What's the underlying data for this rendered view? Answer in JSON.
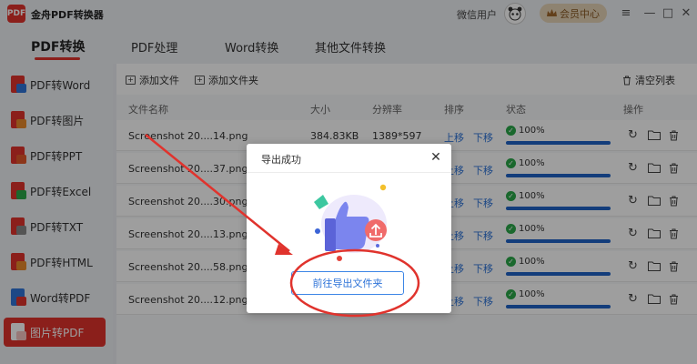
{
  "app": {
    "title": "金舟PDF转换器",
    "logo_text": "PDF",
    "user": "微信用户",
    "vip_label": "会员中心",
    "vip_icon": "crown-icon"
  },
  "window_controls": {
    "menu": "≡",
    "minimize": "—",
    "maximize": "□",
    "close": "✕"
  },
  "tabs": [
    {
      "label": "PDF转换",
      "active": true
    },
    {
      "label": "PDF处理",
      "active": false
    },
    {
      "label": "Word转换",
      "active": false
    },
    {
      "label": "其他文件转换",
      "active": false
    }
  ],
  "sidebar": {
    "items": [
      {
        "label": "PDF转Word",
        "icon": "pdf-to-word-icon",
        "icon_color": "#e0332d",
        "badge_color": "#2f74d8",
        "active": false
      },
      {
        "label": "PDF转图片",
        "icon": "pdf-to-image-icon",
        "icon_color": "#e0332d",
        "badge_color": "#e88a2a",
        "active": false
      },
      {
        "label": "PDF转PPT",
        "icon": "pdf-to-ppt-icon",
        "icon_color": "#e0332d",
        "badge_color": "#e2572b",
        "active": false
      },
      {
        "label": "PDF转Excel",
        "icon": "pdf-to-excel-icon",
        "icon_color": "#e0332d",
        "badge_color": "#2aa84a",
        "active": false
      },
      {
        "label": "PDF转TXT",
        "icon": "pdf-to-txt-icon",
        "icon_color": "#e0332d",
        "badge_color": "#888888",
        "active": false
      },
      {
        "label": "PDF转HTML",
        "icon": "pdf-to-html-icon",
        "icon_color": "#e0332d",
        "badge_color": "#e88a2a",
        "active": false
      },
      {
        "label": "Word转PDF",
        "icon": "word-to-pdf-icon",
        "icon_color": "#2f74d8",
        "badge_color": "#e0332d",
        "active": false
      },
      {
        "label": "图片转PDF",
        "icon": "image-to-pdf-icon",
        "icon_color": "#ffffff",
        "badge_color": "#ffffff",
        "active": true
      }
    ]
  },
  "toolbar": {
    "add_file": "添加文件",
    "add_folder": "添加文件夹",
    "clear_list": "清空列表"
  },
  "columns": {
    "name": "文件名称",
    "size": "大小",
    "resolution": "分辨率",
    "order": "排序",
    "status": "状态",
    "actions": "操作"
  },
  "rows": [
    {
      "name": "Screenshot 20....14.png",
      "size": "384.83KB",
      "resolution": "1389*597",
      "up": "上移",
      "down": "下移",
      "progress_text": "100%",
      "progress": 1.0
    },
    {
      "name": "Screenshot 20....37.png",
      "size": "",
      "resolution": "",
      "up": "上移",
      "down": "下移",
      "progress_text": "100%",
      "progress": 1.0
    },
    {
      "name": "Screenshot 20....30.png",
      "size": "",
      "resolution": "",
      "up": "上移",
      "down": "下移",
      "progress_text": "100%",
      "progress": 1.0
    },
    {
      "name": "Screenshot 20....13.png",
      "size": "",
      "resolution": "",
      "up": "上移",
      "down": "下移",
      "progress_text": "100%",
      "progress": 1.0
    },
    {
      "name": "Screenshot 20....58.png",
      "size": "",
      "resolution": "",
      "up": "上移",
      "down": "下移",
      "progress_text": "100%",
      "progress": 1.0
    },
    {
      "name": "Screenshot 20....12.png",
      "size": "",
      "resolution": "",
      "up": "上移",
      "down": "下移",
      "progress_text": "100%",
      "progress": 1.0
    }
  ],
  "modal": {
    "title": "导出成功",
    "button": "前往导出文件夹",
    "close_icon": "close-icon",
    "illustration": "thumbs-up-export-illustration"
  },
  "colors": {
    "accent": "#e0332d",
    "link": "#2f74d8",
    "progress": "#1f63c7",
    "success": "#2aa84a",
    "annotation": "#e0332d"
  }
}
